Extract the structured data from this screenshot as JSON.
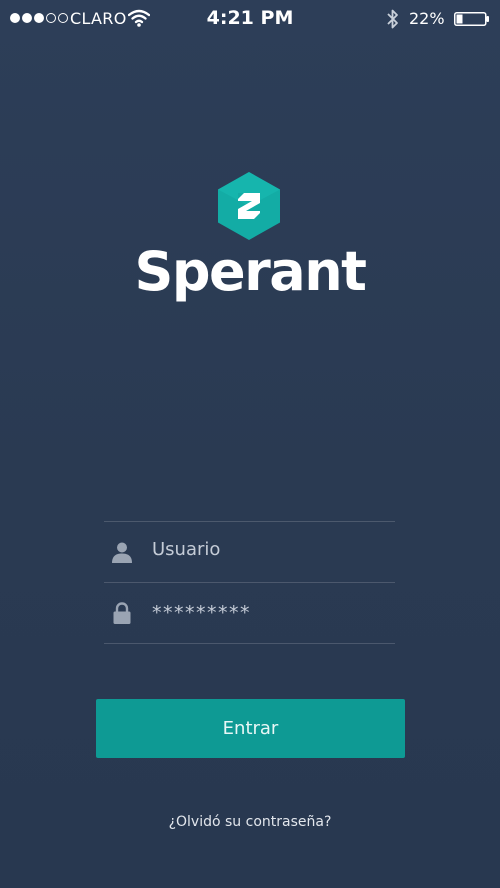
{
  "status_bar": {
    "carrier": "CLARO",
    "time": "4:21 PM",
    "battery_percent": "22%",
    "battery_level": 0.22,
    "signal_bars_filled": 3,
    "signal_bars_total": 5
  },
  "brand": {
    "name": "Sperant",
    "logo_color": "#13aca5"
  },
  "form": {
    "username_placeholder": "Usuario",
    "password_value": "*********",
    "submit_label": "Entrar",
    "forgot_password": "¿Olvidó su contraseña?"
  },
  "colors": {
    "background": "#2c3d56",
    "accent": "#0e9a94"
  }
}
